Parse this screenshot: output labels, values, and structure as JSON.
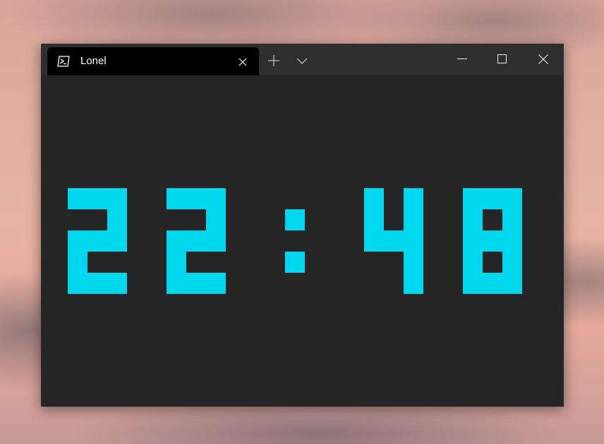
{
  "window": {
    "tab_title": "Lonel",
    "tab_icon": "powershell-icon",
    "new_tab_icon": "plus-icon",
    "dropdown_icon": "chevron-down-icon",
    "minimize_icon": "minimize-icon",
    "maximize_icon": "maximize-icon",
    "close_icon": "close-icon"
  },
  "clock": {
    "time": "22:48",
    "color": "#00d8f0",
    "background": "#252525"
  }
}
